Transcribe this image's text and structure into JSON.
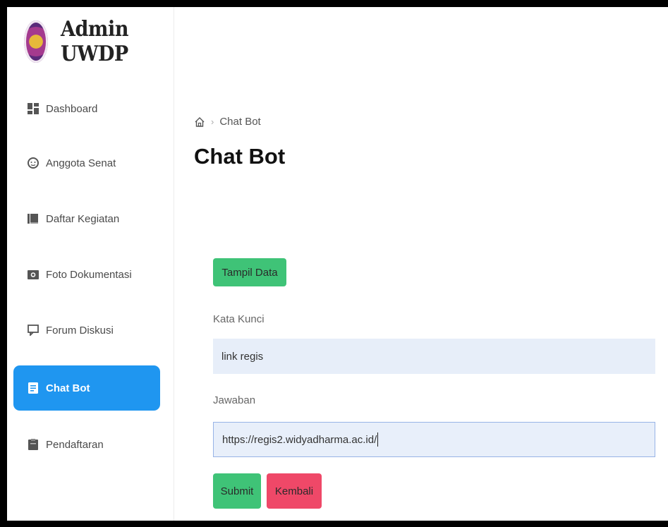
{
  "brand": {
    "title": "Admin UWDP"
  },
  "sidebar": {
    "items": [
      {
        "label": "Dashboard",
        "icon": "dashboard-icon"
      },
      {
        "label": "Anggota Senat",
        "icon": "user-circle-icon"
      },
      {
        "label": "Daftar Kegiatan",
        "icon": "book-icon"
      },
      {
        "label": "Foto Dokumentasi",
        "icon": "camera-icon"
      },
      {
        "label": "Forum Diskusi",
        "icon": "chat-bubble-icon"
      },
      {
        "label": "Chat Bot",
        "icon": "document-icon",
        "active": true
      },
      {
        "label": "Pendaftaran",
        "icon": "clipboard-icon"
      }
    ]
  },
  "breadcrumb": {
    "current": "Chat Bot"
  },
  "page": {
    "title": "Chat Bot"
  },
  "buttons": {
    "tampil_data": "Tampil Data",
    "submit": "Submit",
    "kembali": "Kembali"
  },
  "form": {
    "kata_kunci_label": "Kata Kunci",
    "kata_kunci_value": "link regis",
    "jawaban_label": "Jawaban",
    "jawaban_value": "https://regis2.widyadharma.ac.id/"
  },
  "colors": {
    "active_nav": "#1f96f0",
    "green_button": "#3fc377",
    "red_button": "#ef4868",
    "input_bg": "#e7eef9"
  }
}
